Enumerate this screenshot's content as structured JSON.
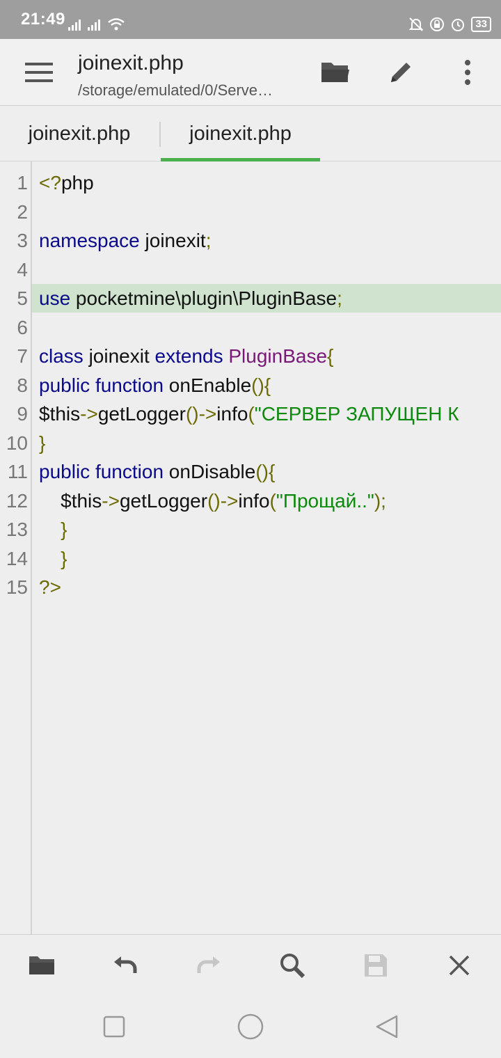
{
  "status_bar": {
    "time": "21:49",
    "battery": "33"
  },
  "app_bar": {
    "title": "joinexit.php",
    "subtitle": "/storage/emulated/0/Serve…"
  },
  "tabs": [
    {
      "label": "joinexit.php",
      "active": false
    },
    {
      "label": "joinexit.php",
      "active": true
    }
  ],
  "editor": {
    "highlighted_line": 5,
    "line_numbers": [
      "1",
      "2",
      "3",
      "4",
      "5",
      "6",
      "7",
      "8",
      "9",
      "10",
      "11",
      "12",
      "13",
      "14",
      "15"
    ],
    "lines": [
      [
        [
          "op",
          "<?"
        ],
        [
          "plain",
          "php"
        ]
      ],
      [],
      [
        [
          "kw",
          "namespace"
        ],
        [
          "plain",
          " joinexit"
        ],
        [
          "op",
          ";"
        ]
      ],
      [],
      [
        [
          "kw",
          "use"
        ],
        [
          "plain",
          " pocketmine\\plugin\\PluginBase"
        ],
        [
          "op",
          ";"
        ]
      ],
      [],
      [
        [
          "kw",
          "class"
        ],
        [
          "plain",
          " joinexit "
        ],
        [
          "kw",
          "extends"
        ],
        [
          "plain",
          " "
        ],
        [
          "cls",
          "PluginBase"
        ],
        [
          "op",
          "{"
        ]
      ],
      [
        [
          "kw",
          "public"
        ],
        [
          "plain",
          " "
        ],
        [
          "kw",
          "function"
        ],
        [
          "plain",
          " onEnable"
        ],
        [
          "op",
          "(){"
        ]
      ],
      [
        [
          "plain",
          "$this"
        ],
        [
          "op",
          "->"
        ],
        [
          "plain",
          "getLogger"
        ],
        [
          "op",
          "()->"
        ],
        [
          "plain",
          "info"
        ],
        [
          "op",
          "("
        ],
        [
          "str",
          "\"СЕРВЕР ЗАПУЩЕН К"
        ]
      ],
      [
        [
          "op",
          "}"
        ]
      ],
      [
        [
          "kw",
          "public"
        ],
        [
          "plain",
          " "
        ],
        [
          "kw",
          "function"
        ],
        [
          "plain",
          " onDisable"
        ],
        [
          "op",
          "(){"
        ]
      ],
      [
        [
          "plain",
          "    $this"
        ],
        [
          "op",
          "->"
        ],
        [
          "plain",
          "getLogger"
        ],
        [
          "op",
          "()->"
        ],
        [
          "plain",
          "info"
        ],
        [
          "op",
          "("
        ],
        [
          "str",
          "\"Прощай..\""
        ],
        [
          "op",
          ");"
        ]
      ],
      [
        [
          "op",
          "    }"
        ]
      ],
      [
        [
          "op",
          "    }"
        ]
      ],
      [
        [
          "op",
          "?>"
        ]
      ]
    ]
  },
  "colors": {
    "accent": "#4caf50",
    "keyword": "#0a0a8a",
    "class": "#7a1878",
    "string": "#0a8a0a",
    "operator": "#6a6a00",
    "highlight": "#cfe3cf"
  },
  "toolbar": {
    "icons": [
      "folder-icon",
      "undo-icon",
      "redo-icon",
      "search-icon",
      "save-icon",
      "close-icon"
    ]
  },
  "navbar": {
    "icons": [
      "recents-icon",
      "home-icon",
      "back-icon"
    ]
  }
}
